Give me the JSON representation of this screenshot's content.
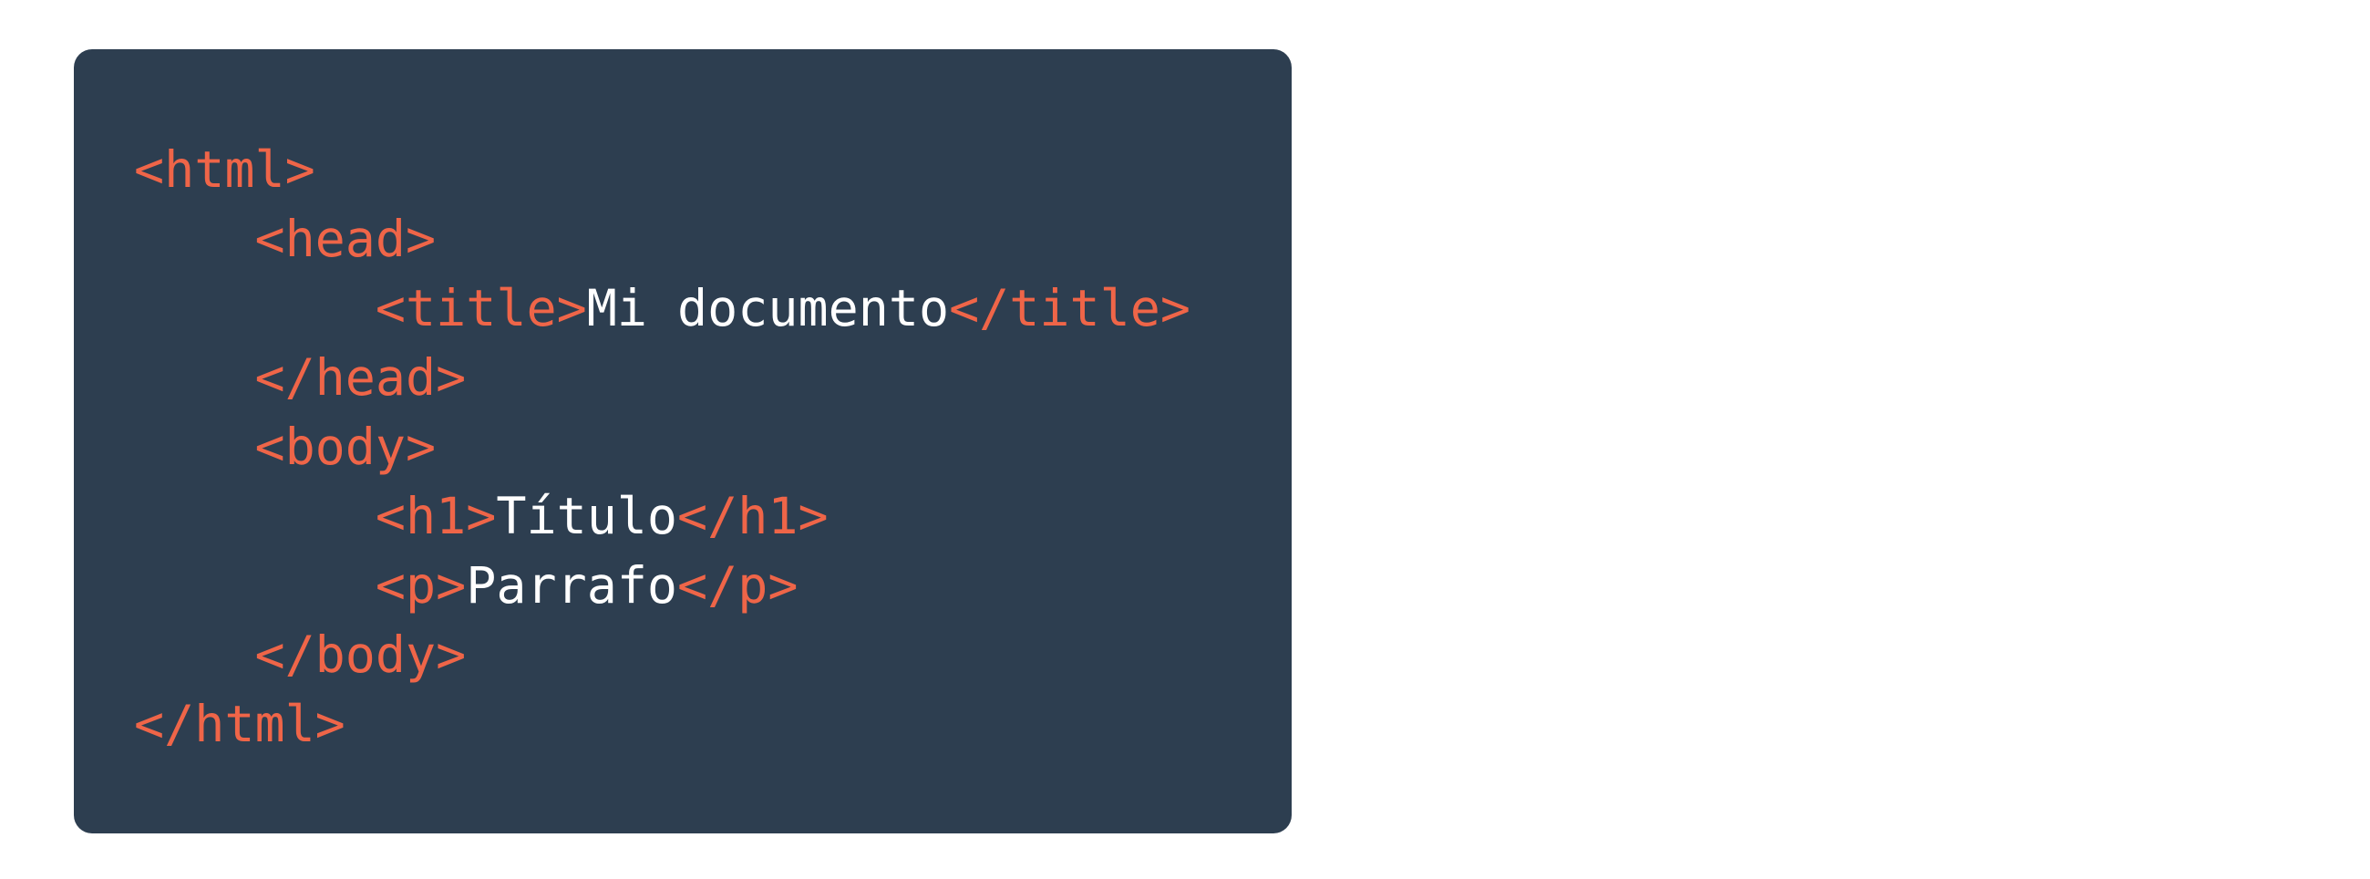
{
  "code": {
    "lines": [
      {
        "indent": 0,
        "parts": [
          {
            "kind": "tag",
            "text": "<html>"
          }
        ]
      },
      {
        "indent": 1,
        "parts": [
          {
            "kind": "tag",
            "text": "<head>"
          }
        ]
      },
      {
        "indent": 2,
        "parts": [
          {
            "kind": "tag",
            "text": "<title>"
          },
          {
            "kind": "text",
            "text": "Mi documento"
          },
          {
            "kind": "tag",
            "text": "</title>"
          }
        ]
      },
      {
        "indent": 1,
        "parts": [
          {
            "kind": "tag",
            "text": "</head>"
          }
        ]
      },
      {
        "indent": 1,
        "parts": [
          {
            "kind": "tag",
            "text": "<body>"
          }
        ]
      },
      {
        "indent": 2,
        "parts": [
          {
            "kind": "tag",
            "text": "<h1>"
          },
          {
            "kind": "text",
            "text": "Título"
          },
          {
            "kind": "tag",
            "text": "</h1>"
          }
        ]
      },
      {
        "indent": 2,
        "parts": [
          {
            "kind": "tag",
            "text": "<p>"
          },
          {
            "kind": "text",
            "text": "Parrafo"
          },
          {
            "kind": "tag",
            "text": "</p>"
          }
        ]
      },
      {
        "indent": 1,
        "parts": [
          {
            "kind": "tag",
            "text": "</body>"
          }
        ]
      },
      {
        "indent": 0,
        "parts": [
          {
            "kind": "tag",
            "text": "</html>"
          }
        ]
      }
    ]
  },
  "colors": {
    "background": "#ffffff",
    "card": "#2d3e50",
    "tag": "#ef6548",
    "text": "#ffffff"
  }
}
